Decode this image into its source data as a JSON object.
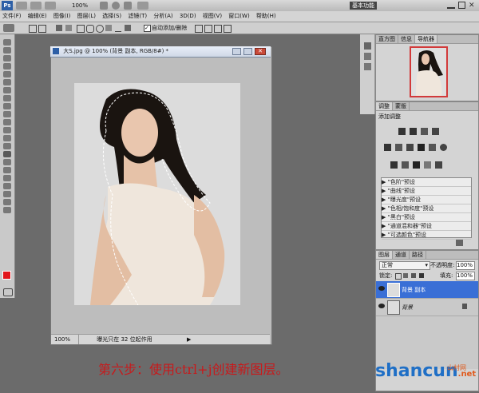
{
  "titlebar": {
    "workspace": "基本功能",
    "zoom": "100%"
  },
  "menu": [
    "文件(F)",
    "编辑(E)",
    "图像(I)",
    "图层(L)",
    "选择(S)",
    "滤镜(T)",
    "分析(A)",
    "3D(D)",
    "视图(V)",
    "窗口(W)",
    "帮助(H)"
  ],
  "options": {
    "antialias": "自动添加/删除"
  },
  "document": {
    "title": "大S.jpg @ 100% (背景 副本, RGB/8#) *",
    "zoom": "100%",
    "status": "曝光只在 32 位起作用"
  },
  "navigator": {
    "tabs": [
      "直方图",
      "信息",
      "导航器"
    ]
  },
  "adjustments": {
    "tabs": [
      "调整",
      "蒙版"
    ],
    "heading": "添加调整",
    "presets": [
      "\"色阶\"预设",
      "\"曲线\"预设",
      "\"曝光度\"预设",
      "\"色相/饱和度\"预设",
      "\"黑白\"预设",
      "\"通道混和器\"预设",
      "\"可选颜色\"预设"
    ]
  },
  "layers": {
    "tabs": [
      "图层",
      "通道",
      "路径"
    ],
    "blend_mode": "正常",
    "opacity_label": "不透明度:",
    "opacity": "100%",
    "lock_label": "锁定:",
    "fill_label": "填充:",
    "fill": "100%",
    "items": [
      {
        "name": "背景 副本",
        "selected": true
      },
      {
        "name": "背景",
        "selected": false
      }
    ]
  },
  "caption": "第六步：使用ctrl+j创建新图层。",
  "watermark": {
    "brand": "shancun",
    "small": "山村网",
    "domain": ".net"
  },
  "colors": {
    "accent": "#3a6fd6",
    "foreground": "#e2171c",
    "caption": "#c8191b",
    "watermark": "#1f6fc6"
  }
}
